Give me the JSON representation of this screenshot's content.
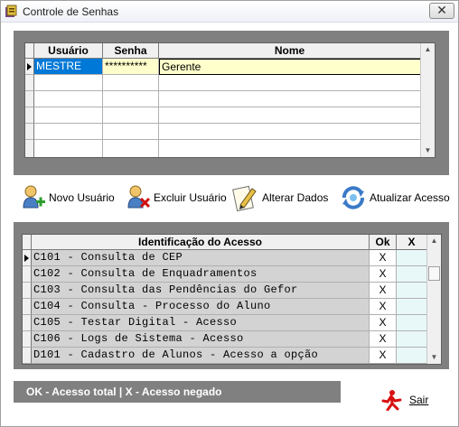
{
  "window": {
    "title": "Controle de Senhas",
    "close_label": "✕"
  },
  "users_grid": {
    "headers": {
      "user": "Usuário",
      "password": "Senha",
      "name": "Nome"
    },
    "rows": [
      {
        "user": "MESTRE",
        "password": "**********",
        "name": "Gerente"
      }
    ]
  },
  "toolbar": {
    "new_user": "Novo Usuário",
    "delete_user": "Excluir Usuário",
    "change_data": "Alterar Dados",
    "update_access": "Atualizar Acesso"
  },
  "access_grid": {
    "headers": {
      "ident": "Identificação do Acesso",
      "ok": "Ok",
      "x": "X"
    },
    "rows": [
      {
        "ident": "C101 - Consulta de CEP",
        "ok": "X",
        "x": ""
      },
      {
        "ident": "C102 - Consulta de Enquadramentos",
        "ok": "X",
        "x": ""
      },
      {
        "ident": "C103 - Consulta das Pendências do Gefor",
        "ok": "X",
        "x": ""
      },
      {
        "ident": "C104 - Consulta - Processo do Aluno",
        "ok": "X",
        "x": ""
      },
      {
        "ident": "C105 - Testar Digital - Acesso",
        "ok": "X",
        "x": ""
      },
      {
        "ident": "C106 - Logs de Sistema - Acesso",
        "ok": "X",
        "x": ""
      },
      {
        "ident": "D101 - Cadastro de Alunos - Acesso a opção",
        "ok": "X",
        "x": ""
      }
    ]
  },
  "legend": "OK - Acesso total  |  X - Acesso negado",
  "exit_label": "Sair",
  "colors": {
    "selection": "#0078d7",
    "highlight_row": "#ffffcc",
    "access_row": "#d3d3d3",
    "x_column": "#e8f8f8"
  }
}
